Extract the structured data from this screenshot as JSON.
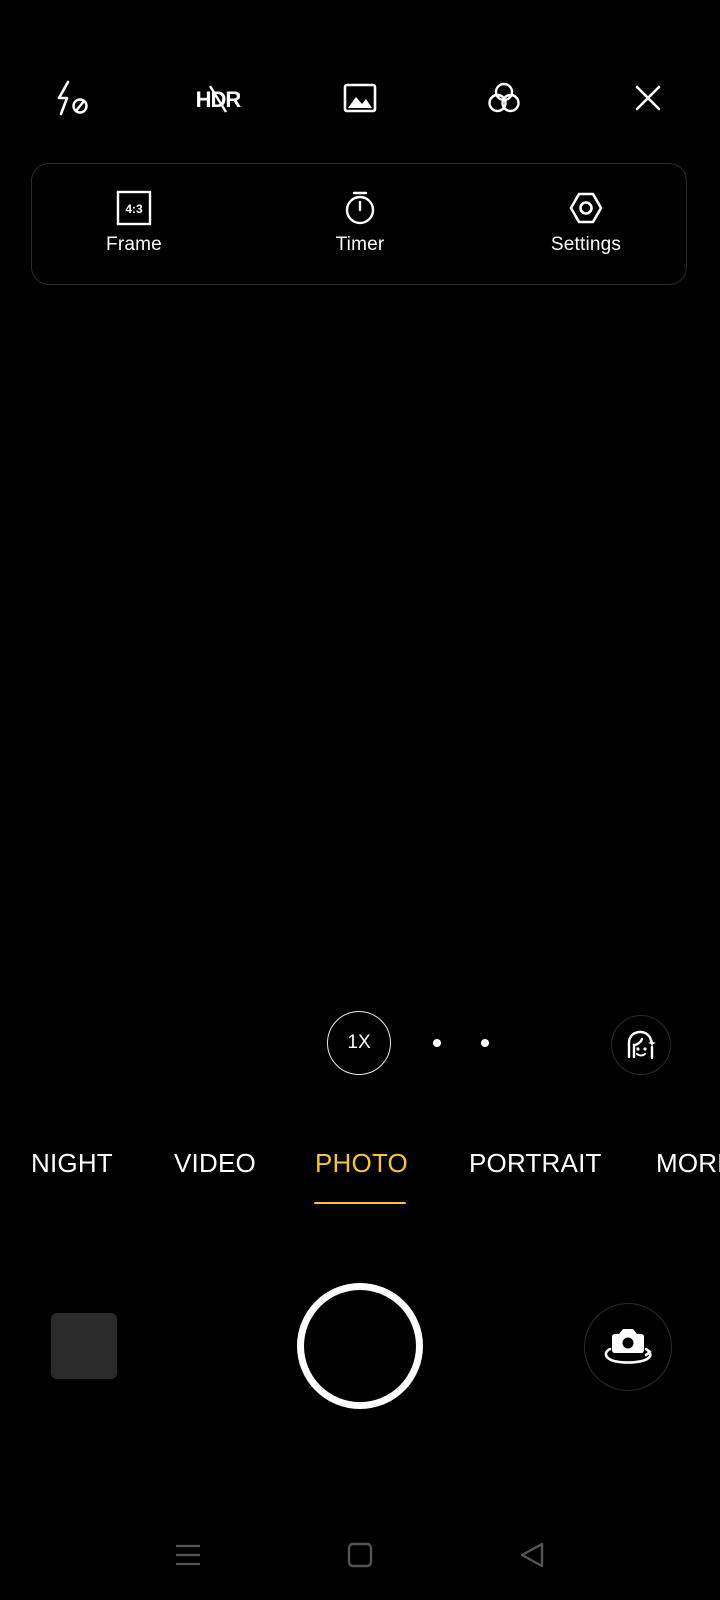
{
  "top_bar": {
    "icons": [
      "flash-off-icon",
      "hdr-off-icon",
      "picture-icon",
      "filters-icon",
      "close-icon"
    ],
    "hdr_text": "HDR"
  },
  "settings_panel": {
    "frame": {
      "label": "Frame",
      "ratio": "4:3"
    },
    "timer": {
      "label": "Timer"
    },
    "settings": {
      "label": "Settings"
    }
  },
  "zoom": {
    "current": "1X"
  },
  "modes": {
    "items": [
      "NIGHT",
      "VIDEO",
      "PHOTO",
      "PORTRAIT",
      "MORE"
    ],
    "active": "PHOTO"
  },
  "colors": {
    "accent": "#f6c342",
    "background": "#000000"
  }
}
